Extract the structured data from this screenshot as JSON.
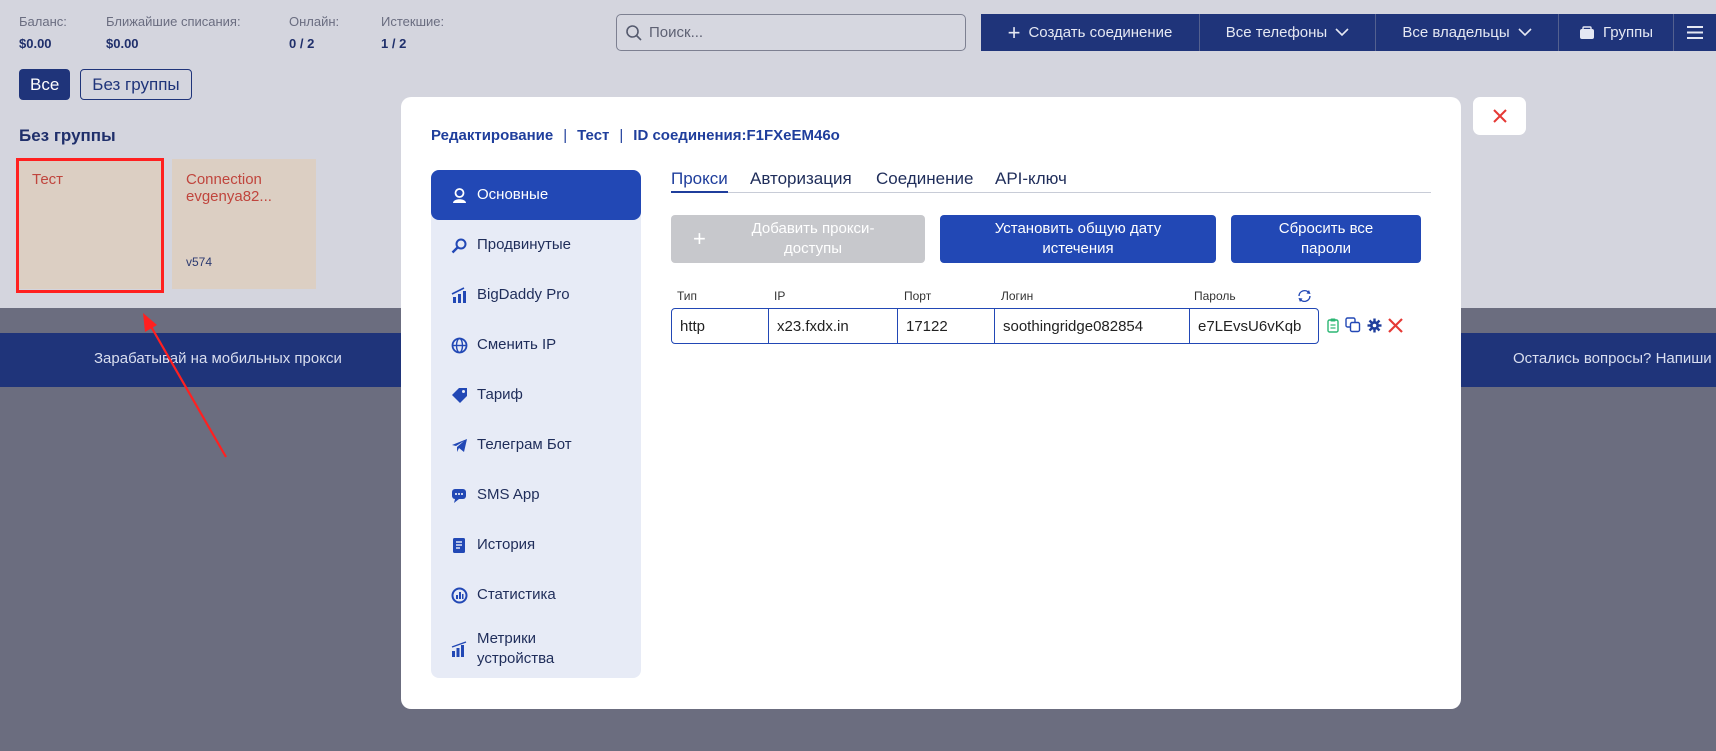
{
  "stats": [
    {
      "label": "Баланс:",
      "value": "$0.00"
    },
    {
      "label": "Ближайшие списания:",
      "value": "$0.00"
    },
    {
      "label": "Онлайн:",
      "value": "0 / 2"
    },
    {
      "label": "Истекшие:",
      "value": "1 / 2"
    }
  ],
  "search": {
    "placeholder": "Поиск..."
  },
  "topbar": {
    "create": "Создать соединение",
    "phones": "Все телефоны",
    "owners": "Все владельцы",
    "groups": "Группы"
  },
  "chips": {
    "all": "Все",
    "no_group": "Без группы"
  },
  "section_title": "Без группы",
  "cards": [
    {
      "name": "Тест",
      "version": ""
    },
    {
      "name": "Connection evgenya82...",
      "version": "v574"
    }
  ],
  "banner": {
    "left": "Зарабатывай на мобильных прокси",
    "right": "Остались вопросы? Напиши"
  },
  "modal": {
    "crumbs": {
      "edit": "Редактирование",
      "name": "Тест",
      "id": "ID соединения:F1FXeEM46o"
    },
    "nav": [
      {
        "label": "Основные",
        "icon": "user-icon"
      },
      {
        "label": "Продвинутые",
        "icon": "wrench-icon"
      },
      {
        "label": "BigDaddy Pro",
        "icon": "chart-up-icon"
      },
      {
        "label": "Сменить IP",
        "icon": "globe-icon"
      },
      {
        "label": "Тариф",
        "icon": "tag-icon"
      },
      {
        "label": "Телеграм Бот",
        "icon": "telegram-icon"
      },
      {
        "label": "SMS App",
        "icon": "chat-icon"
      },
      {
        "label": "История",
        "icon": "history-icon"
      },
      {
        "label": "Статистика",
        "icon": "stats-icon"
      },
      {
        "label": "Метрики устройства",
        "icon": "metrics-icon"
      }
    ],
    "tabs": [
      "Прокси",
      "Авторизация",
      "Соединение",
      "API-ключ"
    ],
    "actions": {
      "add": "Добавить прокси-доступы",
      "set_date": "Установить общую дату истечения",
      "reset": "Сбросить все пароли"
    },
    "columns": {
      "type": "Тип",
      "ip": "IP",
      "port": "Порт",
      "login": "Логин",
      "password": "Пароль"
    },
    "row": {
      "type": "http",
      "ip": "x23.fxdx.in",
      "port": "17122",
      "login": "soothingridge082854",
      "password": "e7LEvsU6vKqb"
    }
  },
  "colors": {
    "brand": "#1f347a",
    "accent": "#2248b5",
    "danger": "#e53935",
    "success": "#2bb673"
  }
}
